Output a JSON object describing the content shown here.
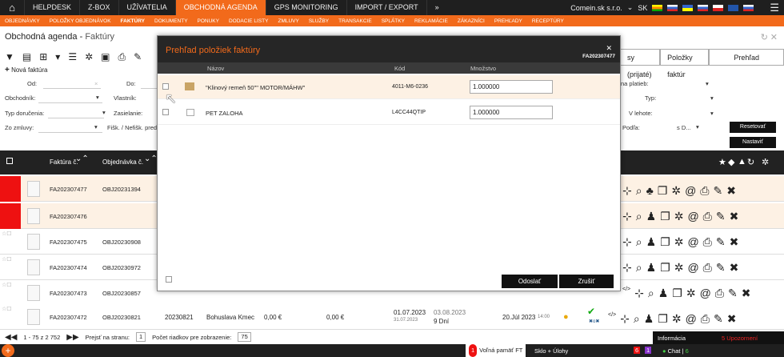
{
  "nav": {
    "tabs": [
      "HELPDESK",
      "Z-BOX",
      "UŽÍVATELIA",
      "OBCHODNÁ AGENDA",
      "GPS MONITORING",
      "IMPORT / EXPORT",
      "»"
    ],
    "active_tab": "OBCHODNÁ AGENDA",
    "company": "Comein.sk s.r.o.",
    "lang": "SK"
  },
  "subnav": [
    "OBJEDNÁVKY",
    "POLOŽKY OBJEDNÁVOK",
    "FAKTÚRY",
    "DOKUMENTY",
    "PONUKY",
    "DODACIE LISTY",
    "ZMLUVY",
    "SLUŽBY",
    "TRANSAKCIE",
    "SPLÁTKY",
    "REKLAMÁCIE",
    "ZÁKAZNÍCI",
    "PREHĽADY",
    "RECEPTÚRY"
  ],
  "page": {
    "title": "Obchodná agenda",
    "crumb": "Faktúry",
    "new_label": "Nová faktúra"
  },
  "filters": {
    "od": "Od:",
    "do": "Do:",
    "obchodnik": "Obchodník:",
    "vlastnik": "Vlastník:",
    "typ_dorucenia": "Typ doručenia:",
    "zasielanie": "Zasielanie:",
    "zo_zmluvy": "Zo zmluvy:",
    "fisk": "Fišk. / Nefišk. predaj",
    "forma_platieb": "na platieb:",
    "typ": "Typ:",
    "v_lehote": "V lehote:",
    "podla": "Podľa:",
    "podla_val": "s D...",
    "reset": "Resetovať",
    "nastavit": "Nastaviť"
  },
  "right_tabs": [
    "sy (prijaté)",
    "Položky faktúr",
    "Prehľad"
  ],
  "grid": {
    "headers": [
      "Faktúra č.",
      "Objednávka č."
    ],
    "rows": [
      {
        "faktura": "FA202307477",
        "objednavka": "OBJ20231394"
      },
      {
        "faktura": "FA202307476",
        "objednavka": ""
      },
      {
        "faktura": "FA202307475",
        "objednavka": "OBJ20230908"
      },
      {
        "faktura": "FA202307474",
        "objednavka": "OBJ20230972"
      },
      {
        "faktura": "FA202307473",
        "objednavka": "OBJ20230857"
      },
      {
        "faktura": "FA202307472",
        "objednavka": "OBJ20230821",
        "ext": "20230821",
        "zakaznik": "Bohuslava Kmec",
        "suma1": "0,00 €",
        "suma2": "0,00 €",
        "d1": "01.07.2023",
        "d1b": "31.07.2023",
        "d2": "03.08.2023",
        "dni": "9 Dní",
        "dat": "20.Júl 2023",
        "cas": "14:00"
      }
    ]
  },
  "modal": {
    "title": "Prehľad položiek faktúry",
    "faktura": "FA202307477",
    "cols": [
      "Názov",
      "Kód",
      "Množstvo"
    ],
    "items": [
      {
        "nazov": "\"Klinový remeň 50\"\" MOTOR/MÁHW\"",
        "kod": "4011-M6-0236",
        "mnozstvo": "1.000000"
      },
      {
        "nazov": "PET ZALOHA",
        "kod": "L4CC44QTIP",
        "mnozstvo": "1.000000"
      }
    ],
    "send": "Odoslať",
    "cancel": "Zrušiť"
  },
  "pager": {
    "range": "1 - 75 z 2 752",
    "go": "Prejsť na stranu:",
    "page": "1",
    "count_label": "Počet riadkov pre zobrazenie:",
    "count": "75"
  },
  "footer": {
    "memory": "Voľná pamäť FT",
    "memory_count": "1",
    "tasks": "Sklo + Úlohy",
    "info": "Informácia",
    "alerts": "5 Upozornení",
    "chat": "Chat",
    "chat_count": "6",
    "b1": "6",
    "b2": "1"
  }
}
